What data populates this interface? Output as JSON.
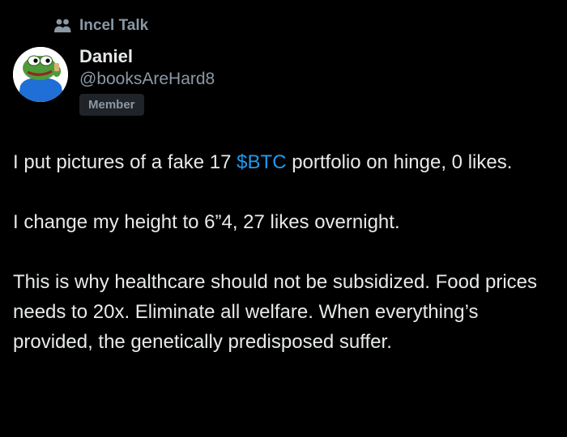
{
  "community": {
    "icon": "community-people-icon",
    "name": "Incel Talk"
  },
  "author": {
    "avatar": "pepe-frog-avatar",
    "display_name": "Daniel",
    "handle": "@booksAreHard8",
    "badge": "Member"
  },
  "tweet": {
    "p1_before": "I put pictures of a fake 17 ",
    "p1_cashtag": "$BTC",
    "p1_after": " portfolio on hinge, 0 likes.",
    "p2": "I change my height to 6”4, 27 likes overnight.",
    "p3": "This is why healthcare should not be subsidized. Food prices needs to 20x. Eliminate all welfare. When everything’s provided, the genetically predisposed suffer."
  },
  "colors": {
    "background": "#000000",
    "text": "#e7e9ea",
    "secondary": "#8b98a5",
    "accent": "#1d9bf0",
    "badge_bg": "#202327"
  }
}
